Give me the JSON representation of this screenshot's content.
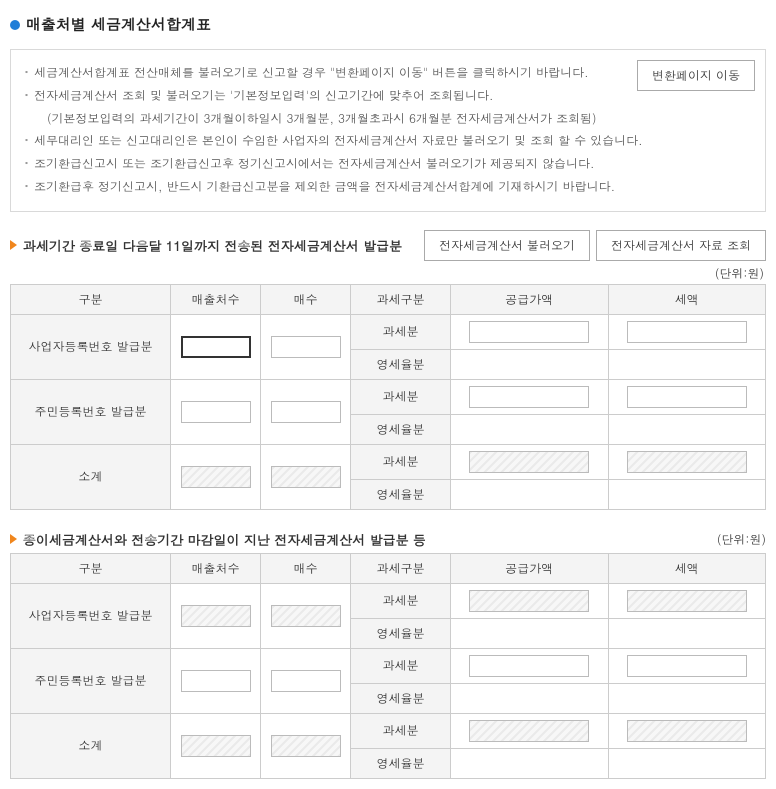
{
  "title": "매출처별 세금계산서합계표",
  "notices": [
    "세금계산서합계표 전산매체를 불러오기로 신고할 경우 \"변환페이지 이동\" 버튼을 클릭하시기 바랍니다.",
    "전자세금계산서 조회 및 불러오기는 '기본정보입력'의 신고기간에 맞추어 조회됩니다.",
    "(기본정보입력의 과세기간이 3개월이하일시 3개월분, 3개월초과시 6개월분 전자세금계산서가 조회됨)",
    "세무대리인 또는 신고대리인은 본인이 수임한 사업자의 전자세금계산서 자료만 불러오기 및 조회 할 수 있습니다.",
    "조기환급신고시 또는 조기환급신고후 정기신고시에서는 전자세금계산서 불러오기가 제공되지 않습니다.",
    "조기환급후 정기신고시, 반드시 기환급신고분을 제외한 금액을 전자세금계산서합계에 기재하시기 바랍니다."
  ],
  "buttons": {
    "convert": "변환페이지 이동",
    "load": "전자세금계산서 불러오기",
    "query": "전자세금계산서 자료 조회"
  },
  "unit_label": "(단위:원)",
  "headers": {
    "gubun": "구분",
    "chul": "매출처수",
    "maesu": "매수",
    "tax_gubun": "과세구분",
    "supply": "공급가액",
    "tax": "세액"
  },
  "tax_row": {
    "gwase": "과세분",
    "youngse": "영세율분"
  },
  "row_labels": {
    "biz": "사업자등록번호 발급분",
    "res": "주민등록번호 발급분",
    "sub": "소계"
  },
  "sections": {
    "s1_title": "과세기간 종료일 다음달 11일까지 전송된 전자세금계산서 발급분",
    "s2_title": "종이세금계산서와 전송기간 마감일이 지난 전자세금계산서 발급분 등"
  }
}
